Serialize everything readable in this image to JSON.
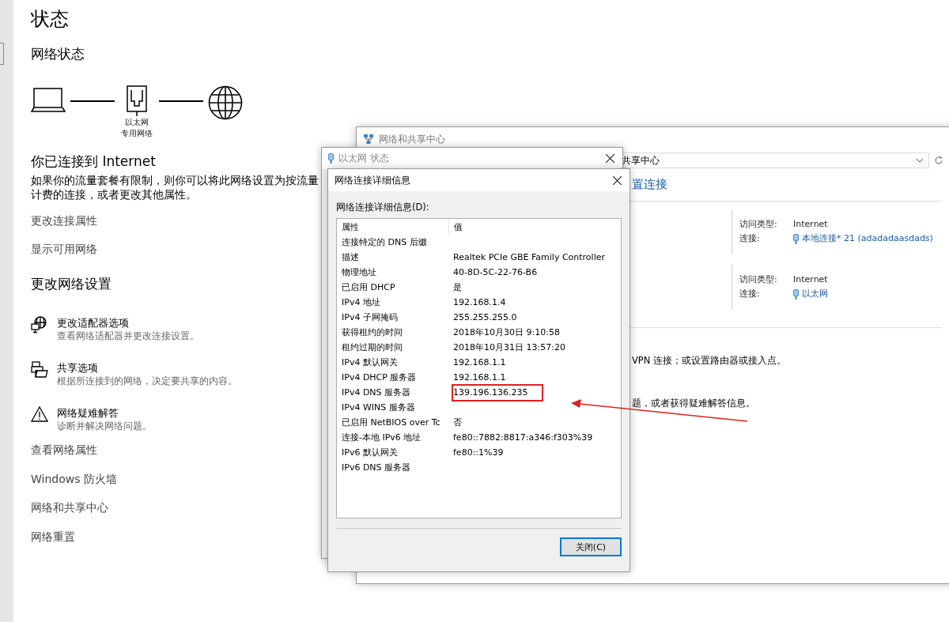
{
  "settings": {
    "title": "状态",
    "section_title": "网络状态",
    "diagram": {
      "adapter_name": "以太网",
      "network_profile": "专用网络"
    },
    "connection_title": "你已连接到 Internet",
    "connection_description": "如果你的流量套餐有限制，则你可以将此网络设置为按流量计费的连接，或者更改其他属性。",
    "links": [
      "更改连接属性",
      "显示可用网络"
    ],
    "change_title": "更改网络设置",
    "options": [
      {
        "kind": "adapter",
        "title": "更改适配器选项",
        "description": "查看网络适配器并更改连接设置。"
      },
      {
        "kind": "sharing",
        "title": "共享选项",
        "description": "根据所连接到的网络，决定要共享的内容。"
      },
      {
        "kind": "troubleshoot",
        "title": "网络疑难解答",
        "description": "诊断并解决网络问题。"
      }
    ],
    "more_links": [
      "查看网络属性",
      "Windows 防火墙",
      "网络和共享中心",
      "网络重置"
    ]
  },
  "sharing_center": {
    "title": "网络和共享中心",
    "address": "共享中心",
    "heading_link": "置连接",
    "networks": [
      {
        "access_label": "访问类型:",
        "access_type": "Internet",
        "connection_label": "连接:",
        "connection": "本地连接* 21 (adadadaasdads)"
      },
      {
        "access_label": "访问类型:",
        "access_type": "Internet",
        "connection_label": "连接:",
        "connection": "以太网"
      }
    ],
    "task_texts": [
      "VPN 连接；或设置路由器或接入点。",
      "题，或者获得疑难解答信息。"
    ]
  },
  "status_window": {
    "title": "以太网 状态"
  },
  "details_dialog": {
    "title": "网络连接详细信息",
    "list_label": "网络连接详细信息(D):",
    "columns": [
      "属性",
      "值"
    ],
    "rows": [
      {
        "property": "连接特定的 DNS 后缀",
        "highlighted": false
      },
      {
        "property": "描述",
        "value": "Realtek PCIe GBE Family Controller",
        "highlighted": false
      },
      {
        "property": "物理地址",
        "value": "40-8D-5C-22-76-B6",
        "highlighted": false
      },
      {
        "property": "已启用 DHCP",
        "value": "是",
        "highlighted": false
      },
      {
        "property": "IPv4 地址",
        "value": "192.168.1.4",
        "highlighted": false
      },
      {
        "property": "IPv4 子网掩码",
        "value": "255.255.255.0",
        "highlighted": false
      },
      {
        "property": "获得租约的时间",
        "value": "2018年10月30日 9:10:58",
        "highlighted": false
      },
      {
        "property": "租约过期的时间",
        "value": "2018年10月31日 13:57:20",
        "highlighted": false
      },
      {
        "property": "IPv4 默认网关",
        "value": "192.168.1.1",
        "highlighted": false
      },
      {
        "property": "IPv4 DHCP 服务器",
        "value": "192.168.1.1",
        "highlighted": false
      },
      {
        "property": "IPv4 DNS 服务器",
        "value": "139.196.136.235",
        "highlighted": true
      },
      {
        "property": "IPv4 WINS 服务器",
        "highlighted": false
      },
      {
        "property": "已启用 NetBIOS over Tc",
        "value": "否",
        "highlighted": false
      },
      {
        "property": "连接-本地 IPv6 地址",
        "value": "fe80::7882:8817:a346:f303%39",
        "highlighted": false
      },
      {
        "property": "IPv6 默认网关",
        "value": "fe80::1%39",
        "highlighted": false
      },
      {
        "property": "IPv6 DNS 服务器",
        "highlighted": false
      }
    ],
    "button": "关闭(C)"
  }
}
